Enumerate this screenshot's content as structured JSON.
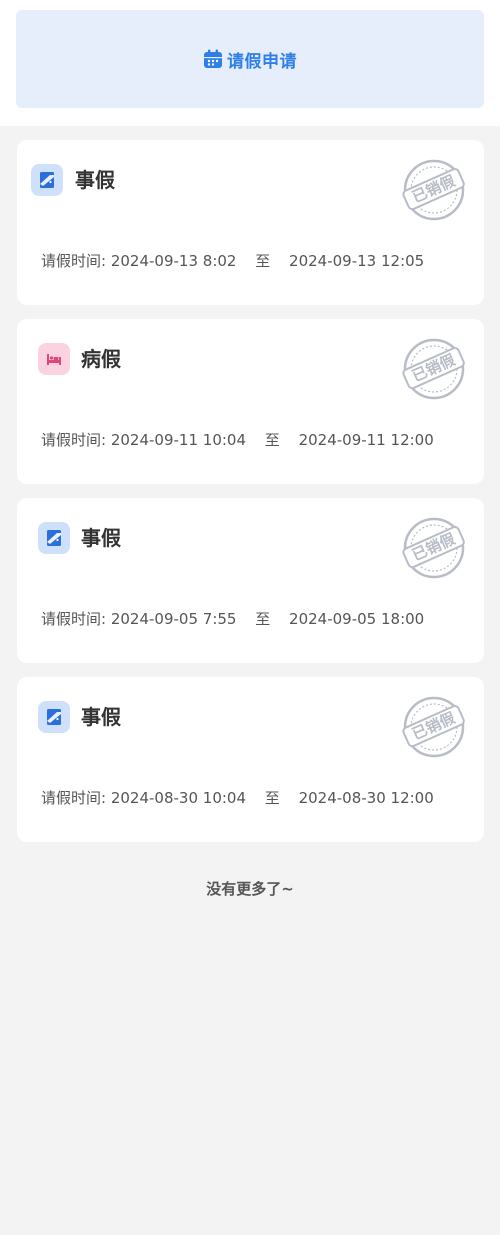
{
  "header": {
    "apply_label": "请假申请",
    "accent_color": "#2f7fe8",
    "icon": "calendar-icon"
  },
  "leave_list": [
    {
      "type": "事假",
      "icon": "door-icon",
      "stamp": "已销假",
      "time_label": "请假时间:",
      "start": "2024-09-13 8:02",
      "to": "至",
      "end": "2024-09-13 12:05"
    },
    {
      "type": "病假",
      "icon": "bed-icon",
      "stamp": "已销假",
      "time_label": "请假时间:",
      "start": "2024-09-11 10:04",
      "to": "至",
      "end": "2024-09-11 12:00"
    },
    {
      "type": "事假",
      "icon": "door-icon",
      "stamp": "已销假",
      "time_label": "请假时间:",
      "start": "2024-09-05 7:55",
      "to": "至",
      "end": "2024-09-05 18:00"
    },
    {
      "type": "事假",
      "icon": "door-icon",
      "stamp": "已销假",
      "time_label": "请假时间:",
      "start": "2024-08-30 10:04",
      "to": "至",
      "end": "2024-08-30 12:00"
    }
  ],
  "footer": {
    "no_more": "没有更多了~"
  }
}
